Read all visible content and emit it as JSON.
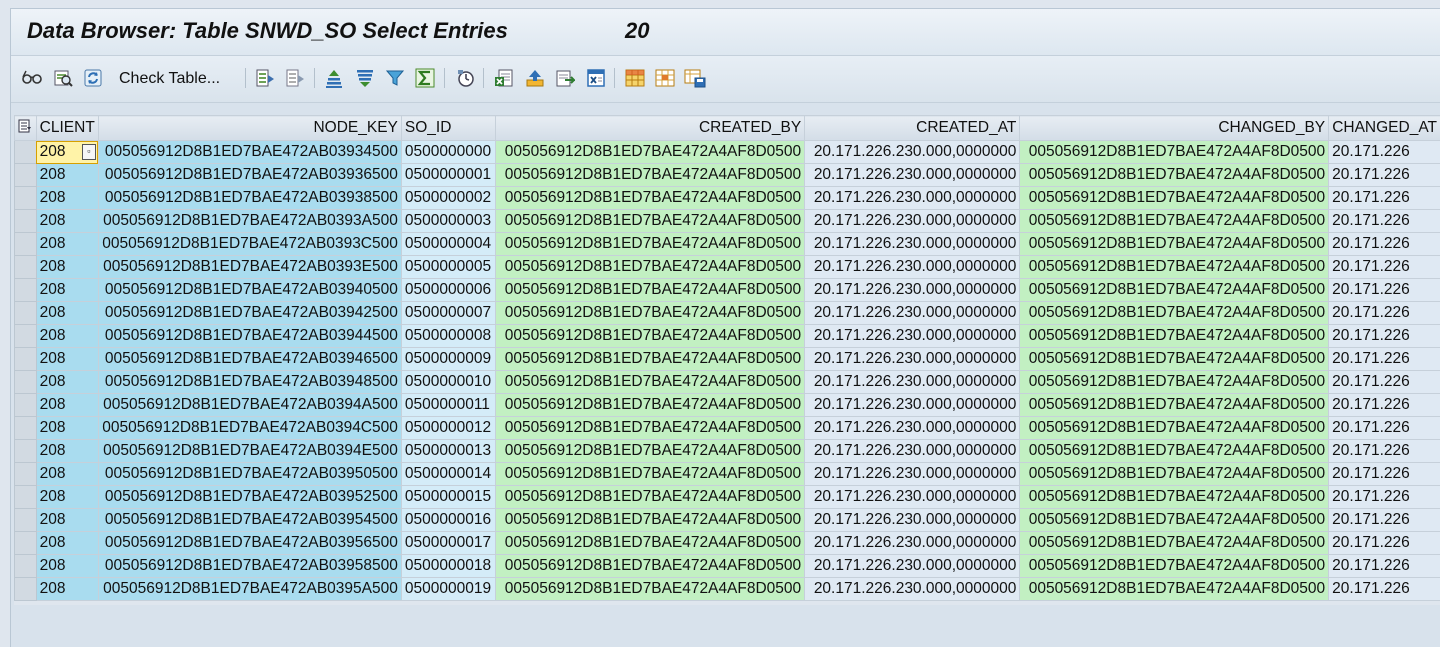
{
  "window": {
    "title": "Data Browser: Table SNWD_SO Select Entries",
    "entry_count": "20"
  },
  "toolbar": {
    "check_table_label": "Check Table...",
    "icons": [
      "glasses-icon",
      "display-detail-icon",
      "refresh-icon",
      "check-table-icon",
      "select-all-icon",
      "deselect-all-icon",
      "sort-ascending-icon",
      "sort-descending-icon",
      "filter-icon",
      "sum-icon",
      "timer-icon",
      "export-excel-icon",
      "upload-icon",
      "local-file-icon",
      "word-processing-icon",
      "layout-grid-icon",
      "select-layout-icon",
      "save-layout-icon"
    ]
  },
  "table": {
    "columns": [
      "CLIENT",
      "NODE_KEY",
      "SO_ID",
      "CREATED_BY",
      "CREATED_AT",
      "CHANGED_BY",
      "CHANGED_AT"
    ],
    "rows": [
      [
        "208",
        "005056912D8B1ED7BAE472AB03934500",
        "0500000000",
        "005056912D8B1ED7BAE472A4AF8D0500",
        "20.171.226.230.000,0000000",
        "005056912D8B1ED7BAE472A4AF8D0500",
        "20.171.226"
      ],
      [
        "208",
        "005056912D8B1ED7BAE472AB03936500",
        "0500000001",
        "005056912D8B1ED7BAE472A4AF8D0500",
        "20.171.226.230.000,0000000",
        "005056912D8B1ED7BAE472A4AF8D0500",
        "20.171.226"
      ],
      [
        "208",
        "005056912D8B1ED7BAE472AB03938500",
        "0500000002",
        "005056912D8B1ED7BAE472A4AF8D0500",
        "20.171.226.230.000,0000000",
        "005056912D8B1ED7BAE472A4AF8D0500",
        "20.171.226"
      ],
      [
        "208",
        "005056912D8B1ED7BAE472AB0393A500",
        "0500000003",
        "005056912D8B1ED7BAE472A4AF8D0500",
        "20.171.226.230.000,0000000",
        "005056912D8B1ED7BAE472A4AF8D0500",
        "20.171.226"
      ],
      [
        "208",
        "005056912D8B1ED7BAE472AB0393C500",
        "0500000004",
        "005056912D8B1ED7BAE472A4AF8D0500",
        "20.171.226.230.000,0000000",
        "005056912D8B1ED7BAE472A4AF8D0500",
        "20.171.226"
      ],
      [
        "208",
        "005056912D8B1ED7BAE472AB0393E500",
        "0500000005",
        "005056912D8B1ED7BAE472A4AF8D0500",
        "20.171.226.230.000,0000000",
        "005056912D8B1ED7BAE472A4AF8D0500",
        "20.171.226"
      ],
      [
        "208",
        "005056912D8B1ED7BAE472AB03940500",
        "0500000006",
        "005056912D8B1ED7BAE472A4AF8D0500",
        "20.171.226.230.000,0000000",
        "005056912D8B1ED7BAE472A4AF8D0500",
        "20.171.226"
      ],
      [
        "208",
        "005056912D8B1ED7BAE472AB03942500",
        "0500000007",
        "005056912D8B1ED7BAE472A4AF8D0500",
        "20.171.226.230.000,0000000",
        "005056912D8B1ED7BAE472A4AF8D0500",
        "20.171.226"
      ],
      [
        "208",
        "005056912D8B1ED7BAE472AB03944500",
        "0500000008",
        "005056912D8B1ED7BAE472A4AF8D0500",
        "20.171.226.230.000,0000000",
        "005056912D8B1ED7BAE472A4AF8D0500",
        "20.171.226"
      ],
      [
        "208",
        "005056912D8B1ED7BAE472AB03946500",
        "0500000009",
        "005056912D8B1ED7BAE472A4AF8D0500",
        "20.171.226.230.000,0000000",
        "005056912D8B1ED7BAE472A4AF8D0500",
        "20.171.226"
      ],
      [
        "208",
        "005056912D8B1ED7BAE472AB03948500",
        "0500000010",
        "005056912D8B1ED7BAE472A4AF8D0500",
        "20.171.226.230.000,0000000",
        "005056912D8B1ED7BAE472A4AF8D0500",
        "20.171.226"
      ],
      [
        "208",
        "005056912D8B1ED7BAE472AB0394A500",
        "0500000011",
        "005056912D8B1ED7BAE472A4AF8D0500",
        "20.171.226.230.000,0000000",
        "005056912D8B1ED7BAE472A4AF8D0500",
        "20.171.226"
      ],
      [
        "208",
        "005056912D8B1ED7BAE472AB0394C500",
        "0500000012",
        "005056912D8B1ED7BAE472A4AF8D0500",
        "20.171.226.230.000,0000000",
        "005056912D8B1ED7BAE472A4AF8D0500",
        "20.171.226"
      ],
      [
        "208",
        "005056912D8B1ED7BAE472AB0394E500",
        "0500000013",
        "005056912D8B1ED7BAE472A4AF8D0500",
        "20.171.226.230.000,0000000",
        "005056912D8B1ED7BAE472A4AF8D0500",
        "20.171.226"
      ],
      [
        "208",
        "005056912D8B1ED7BAE472AB03950500",
        "0500000014",
        "005056912D8B1ED7BAE472A4AF8D0500",
        "20.171.226.230.000,0000000",
        "005056912D8B1ED7BAE472A4AF8D0500",
        "20.171.226"
      ],
      [
        "208",
        "005056912D8B1ED7BAE472AB03952500",
        "0500000015",
        "005056912D8B1ED7BAE472A4AF8D0500",
        "20.171.226.230.000,0000000",
        "005056912D8B1ED7BAE472A4AF8D0500",
        "20.171.226"
      ],
      [
        "208",
        "005056912D8B1ED7BAE472AB03954500",
        "0500000016",
        "005056912D8B1ED7BAE472A4AF8D0500",
        "20.171.226.230.000,0000000",
        "005056912D8B1ED7BAE472A4AF8D0500",
        "20.171.226"
      ],
      [
        "208",
        "005056912D8B1ED7BAE472AB03956500",
        "0500000017",
        "005056912D8B1ED7BAE472A4AF8D0500",
        "20.171.226.230.000,0000000",
        "005056912D8B1ED7BAE472A4AF8D0500",
        "20.171.226"
      ],
      [
        "208",
        "005056912D8B1ED7BAE472AB03958500",
        "0500000018",
        "005056912D8B1ED7BAE472A4AF8D0500",
        "20.171.226.230.000,0000000",
        "005056912D8B1ED7BAE472A4AF8D0500",
        "20.171.226"
      ],
      [
        "208",
        "005056912D8B1ED7BAE472AB0395A500",
        "0500000019",
        "005056912D8B1ED7BAE472A4AF8D0500",
        "20.171.226.230.000,0000000",
        "005056912D8B1ED7BAE472A4AF8D0500",
        "20.171.226"
      ]
    ]
  }
}
